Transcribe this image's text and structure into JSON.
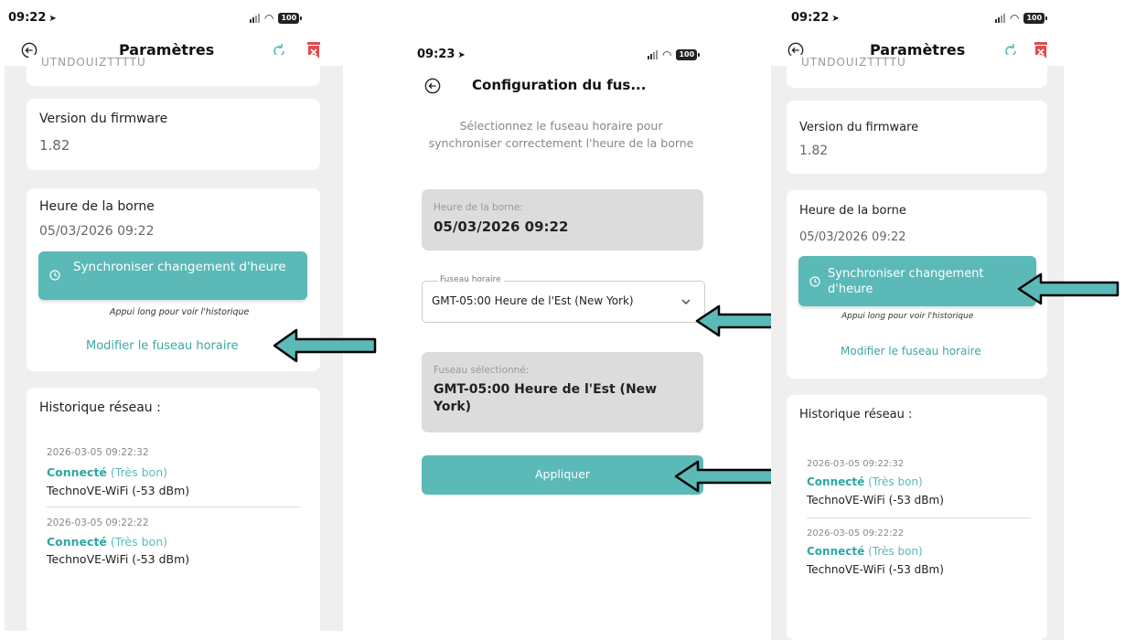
{
  "status": {
    "time_left": "09:22",
    "time_middle": "09:23",
    "time_right": "09:22",
    "battery": "100"
  },
  "settings": {
    "title": "Paramètres",
    "truncated_top": "UTNDOUIZTTTTU",
    "firmware_label": "Version du firmware",
    "firmware_value": "1.82",
    "clock_label": "Heure de la borne",
    "clock_value": "05/03/2026 09:22",
    "sync_button": "Synchroniser changement d'heure",
    "sync_hint": "Appui long pour voir l'historique",
    "timezone_link": "Modifier le fuseau horaire",
    "history_title": "Historique réseau :",
    "history": [
      {
        "date": "2026-03-05 09:22:32",
        "status": "Connecté",
        "quality": "(Très bon)",
        "network": "TechnoVE-WiFi (-53 dBm)"
      },
      {
        "date": "2026-03-05 09:22:22",
        "status": "Connecté",
        "quality": "(Très bon)",
        "network": "TechnoVE-WiFi (-53 dBm)"
      }
    ]
  },
  "timezone_config": {
    "title": "Configuration du fus...",
    "description": "Sélectionnez le fuseau horaire pour synchroniser correctement l'heure de la borne",
    "clock_label": "Heure de la borne:",
    "clock_value": "05/03/2026 09:22",
    "select_label": "Fuseau horaire",
    "select_value": "GMT-05:00 Heure de l'Est (New York)",
    "selected_label": "Fuseau sélectionné:",
    "selected_value": "GMT-05:00 Heure de l'Est (New York)",
    "apply_button": "Appliquer"
  },
  "colors": {
    "accent": "#5bb9b8",
    "link": "#3fa6a3",
    "delete": "#e04b4b",
    "arrow_fill": "#5bb9b8"
  }
}
